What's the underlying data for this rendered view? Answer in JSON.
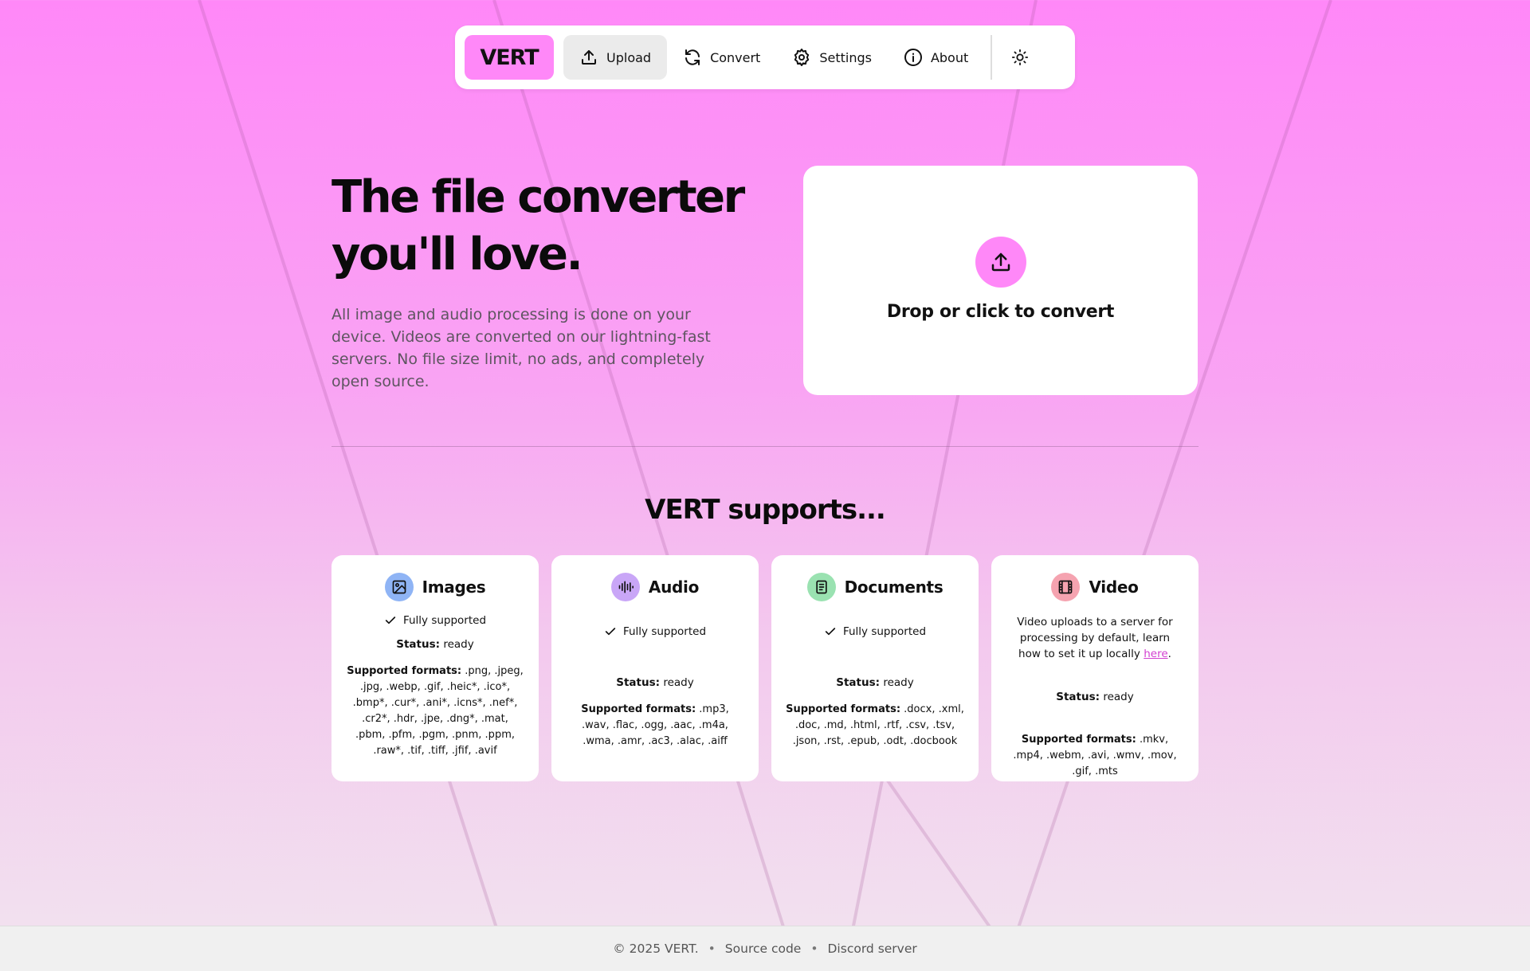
{
  "nav": {
    "logo": "VERT",
    "items": [
      {
        "label": "Upload",
        "icon": "upload-icon",
        "active": true
      },
      {
        "label": "Convert",
        "icon": "refresh-icon",
        "active": false
      },
      {
        "label": "Settings",
        "icon": "gear-icon",
        "active": false
      },
      {
        "label": "About",
        "icon": "info-icon",
        "active": false
      }
    ],
    "theme_icon": "sun-icon"
  },
  "hero": {
    "title_line1": "The file converter",
    "title_line2": "you'll love.",
    "description": "All image and audio processing is done on your device. Videos are converted on our lightning-fast servers. No file size limit, no ads, and completely open source."
  },
  "dropzone": {
    "label": "Drop or click to convert",
    "icon": "upload-icon"
  },
  "supports": {
    "title": "VERT supports...",
    "cards": [
      {
        "title": "Images",
        "icon": "image-icon",
        "icon_color": "#8fb4f5",
        "support": "Fully supported",
        "status_label": "Status:",
        "status": "ready",
        "formats_label": "Supported formats:",
        "formats": ".png, .jpeg, .jpg, .webp, .gif, .heic*, .ico*, .bmp*, .cur*, .ani*, .icns*, .nef*, .cr2*, .hdr, .jpe, .dng*, .mat, .pbm, .pfm, .pgm, .pnm, .ppm, .raw*, .tif, .tiff, .jfif, .avif"
      },
      {
        "title": "Audio",
        "icon": "audio-waveform-icon",
        "icon_color": "#c9a6f7",
        "support": "Fully supported",
        "status_label": "Status:",
        "status": "ready",
        "formats_label": "Supported formats:",
        "formats": ".mp3, .wav, .flac, .ogg, .aac, .m4a, .wma, .amr, .ac3, .alac, .aiff"
      },
      {
        "title": "Documents",
        "icon": "document-icon",
        "icon_color": "#9ae2b1",
        "support": "Fully supported",
        "status_label": "Status:",
        "status": "ready",
        "formats_label": "Supported formats:",
        "formats": ".docx, .xml, .doc, .md, .html, .rtf, .csv, .tsv, .json, .rst, .epub, .odt, .docbook"
      },
      {
        "title": "Video",
        "icon": "film-icon",
        "icon_color": "#f5a3b0",
        "note": "Video uploads to a server for processing by default, learn how to set it up locally",
        "note_link": "here",
        "note_end": ".",
        "status_label": "Status:",
        "status": "ready",
        "formats_label": "Supported formats:",
        "formats": ".mkv, .mp4, .webm, .avi, .wmv, .mov, .gif, .mts"
      }
    ]
  },
  "footer": {
    "copyright": "© 2025 VERT.",
    "sep": "•",
    "source": "Source code",
    "discord": "Discord server"
  }
}
